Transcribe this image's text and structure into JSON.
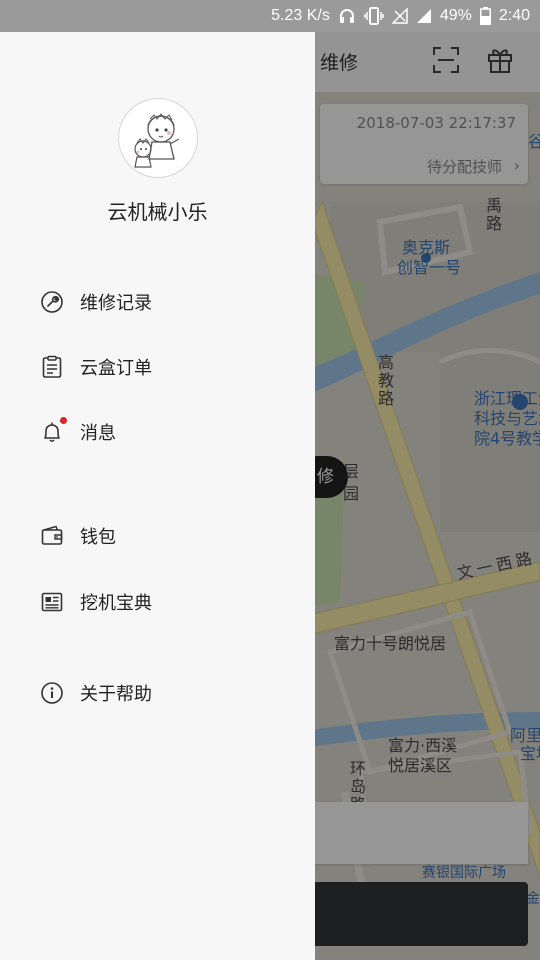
{
  "status_bar": {
    "speed": "5.23 K/s",
    "battery": "49%",
    "time": "2:40"
  },
  "background": {
    "header_title": "维修",
    "card_time": "2018-07-03 22:17:37",
    "card_status": "待分配技师",
    "card_arrow": "›",
    "repair_pill": "修",
    "map_labels": {
      "gu": "谷",
      "yu": "禹",
      "lu": "路",
      "aokes": "奥克斯",
      "chuangzhi": "创智一号",
      "gaojiaolu": "高教路",
      "zhejiang1": "浙江理工大",
      "zhejiang2": "科技与艺术",
      "zhejiang3": "院4号教学",
      "ceng": "层",
      "yuan": "园",
      "wenyixilu": "文一西路",
      "fuli10": "富力十号朗悦居",
      "fuli_xixi1": "富力·西溪",
      "fuli_xixi2": "悦居溪区",
      "huandao": "环岛路",
      "ali1": "阿里",
      "ali2": "宝地",
      "saiyin": "赛银国际广场",
      "jin": "金"
    }
  },
  "drawer": {
    "username": "云机械小乐",
    "menu": [
      {
        "label": "维修记录",
        "icon": "wrench-icon"
      },
      {
        "label": "云盒订单",
        "icon": "clipboard-icon"
      },
      {
        "label": "消息",
        "icon": "bell-icon"
      },
      {
        "label": "钱包",
        "icon": "wallet-icon"
      },
      {
        "label": "挖机宝典",
        "icon": "newspaper-icon"
      },
      {
        "label": "关于帮助",
        "icon": "info-icon"
      }
    ]
  },
  "colors": {
    "drawer_bg": "#f7f7f7",
    "notification_dot": "#e0202a",
    "map_road": "#f5e9a8",
    "map_water": "#9fc4e6",
    "map_green": "#c6e0b0"
  }
}
